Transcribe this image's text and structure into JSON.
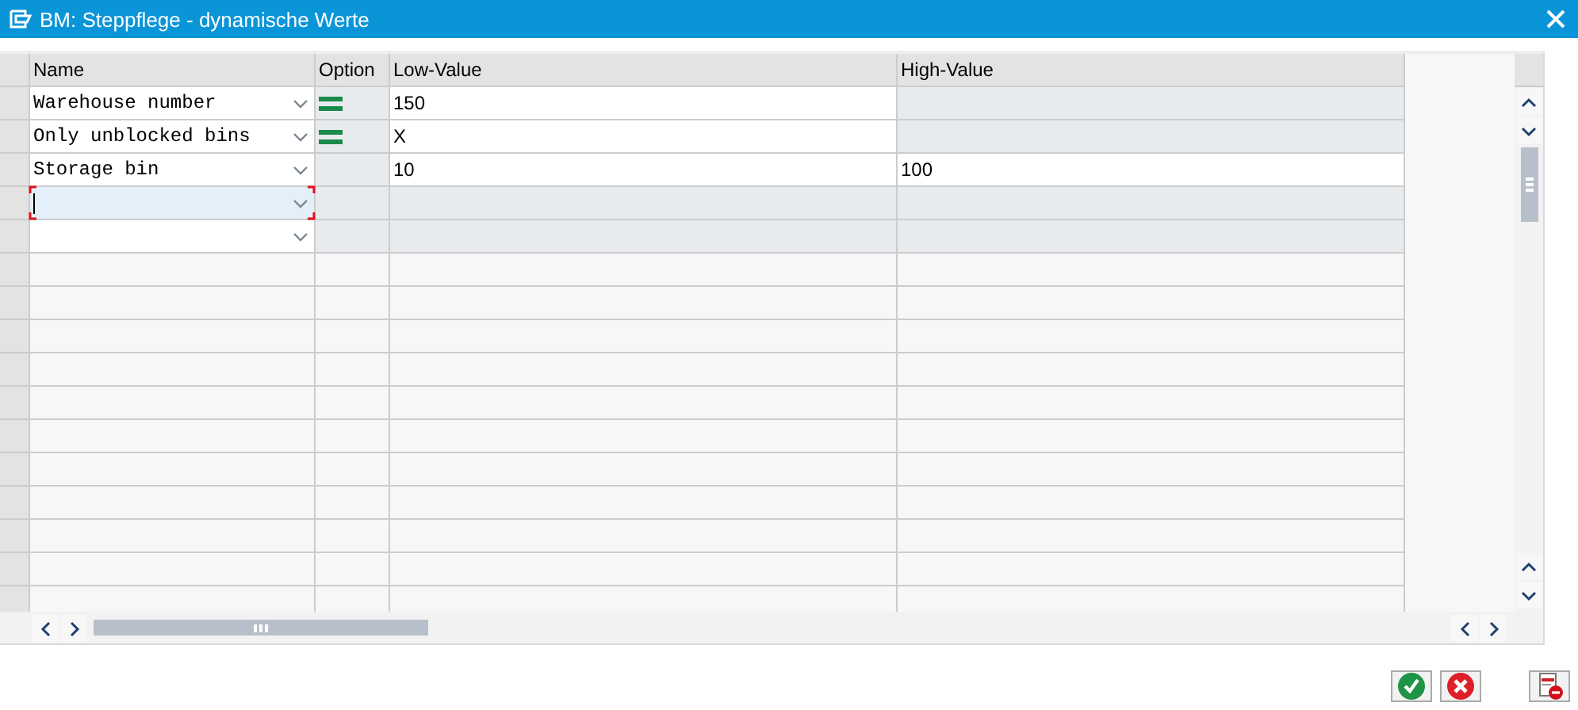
{
  "window": {
    "title": "BM: Steppflege - dynamische Werte"
  },
  "table": {
    "columns": [
      "Name",
      "Option",
      "Low-Value",
      "High-Value"
    ],
    "rows": [
      {
        "name": "Warehouse number",
        "option_equals": true,
        "low": "150",
        "low_editable": true,
        "high_editable": false,
        "focused": false
      },
      {
        "name": "Only unblocked bins",
        "option_equals": true,
        "low": "X",
        "low_editable": true,
        "high_editable": false,
        "focused": false
      },
      {
        "name": "Storage bin",
        "option_equals": false,
        "low": "10",
        "high": "100",
        "low_editable": true,
        "high_editable": true,
        "focused": false
      },
      {
        "name": "",
        "option_equals": false,
        "low_editable": false,
        "high_editable": false,
        "focused": true
      },
      {
        "name": "",
        "option_equals": false,
        "low_editable": false,
        "high_editable": false,
        "focused": false
      }
    ]
  }
}
